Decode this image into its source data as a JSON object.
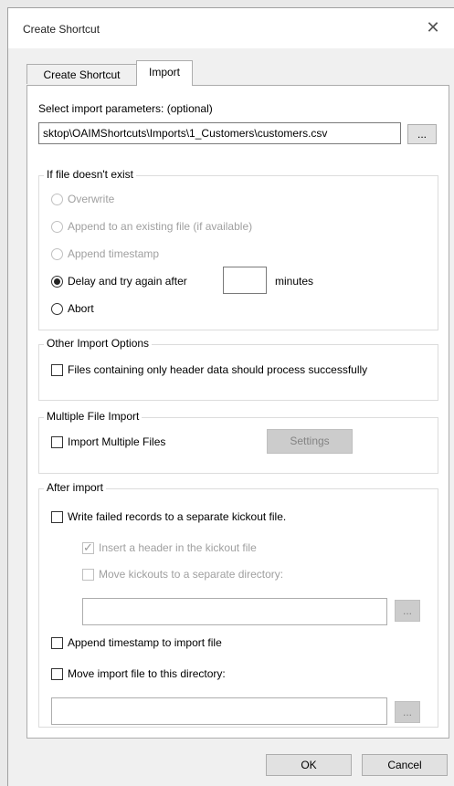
{
  "window": {
    "title": "Create Shortcut",
    "close_glyph": "✕"
  },
  "tabs": [
    {
      "label": "Create Shortcut",
      "active": false
    },
    {
      "label": "Import",
      "active": true
    }
  ],
  "import_params": {
    "label": "Select import parameters: (optional)",
    "value": "sktop\\OAIMShortcuts\\Imports\\1_Customers\\customers.csv",
    "browse_label": "..."
  },
  "file_missing": {
    "title": "If file doesn't exist",
    "overwrite": "Overwrite",
    "append_existing": "Append to an existing file (if available)",
    "append_timestamp": "Append timestamp",
    "delay": "Delay and try again after",
    "delay_value": "",
    "minutes": "minutes",
    "abort": "Abort",
    "selected": "delay"
  },
  "other_options": {
    "title": "Other Import Options",
    "header_only": "Files containing only header data should process successfully"
  },
  "multiple_import": {
    "title": "Multiple File Import",
    "import_multiple": "Import Multiple Files",
    "settings_label": "Settings"
  },
  "after_import": {
    "title": "After import",
    "write_failed": "Write failed records to a separate kickout file.",
    "insert_header": "Insert a header in the kickout file",
    "move_kickouts": "Move kickouts to a separate directory:",
    "kickout_dir_value": "",
    "browse_label": "...",
    "append_timestamp": "Append timestamp to import file",
    "move_import": "Move import file to this directory:",
    "import_dir_value": ""
  },
  "footer": {
    "ok_label": "OK",
    "cancel_label": "Cancel"
  }
}
